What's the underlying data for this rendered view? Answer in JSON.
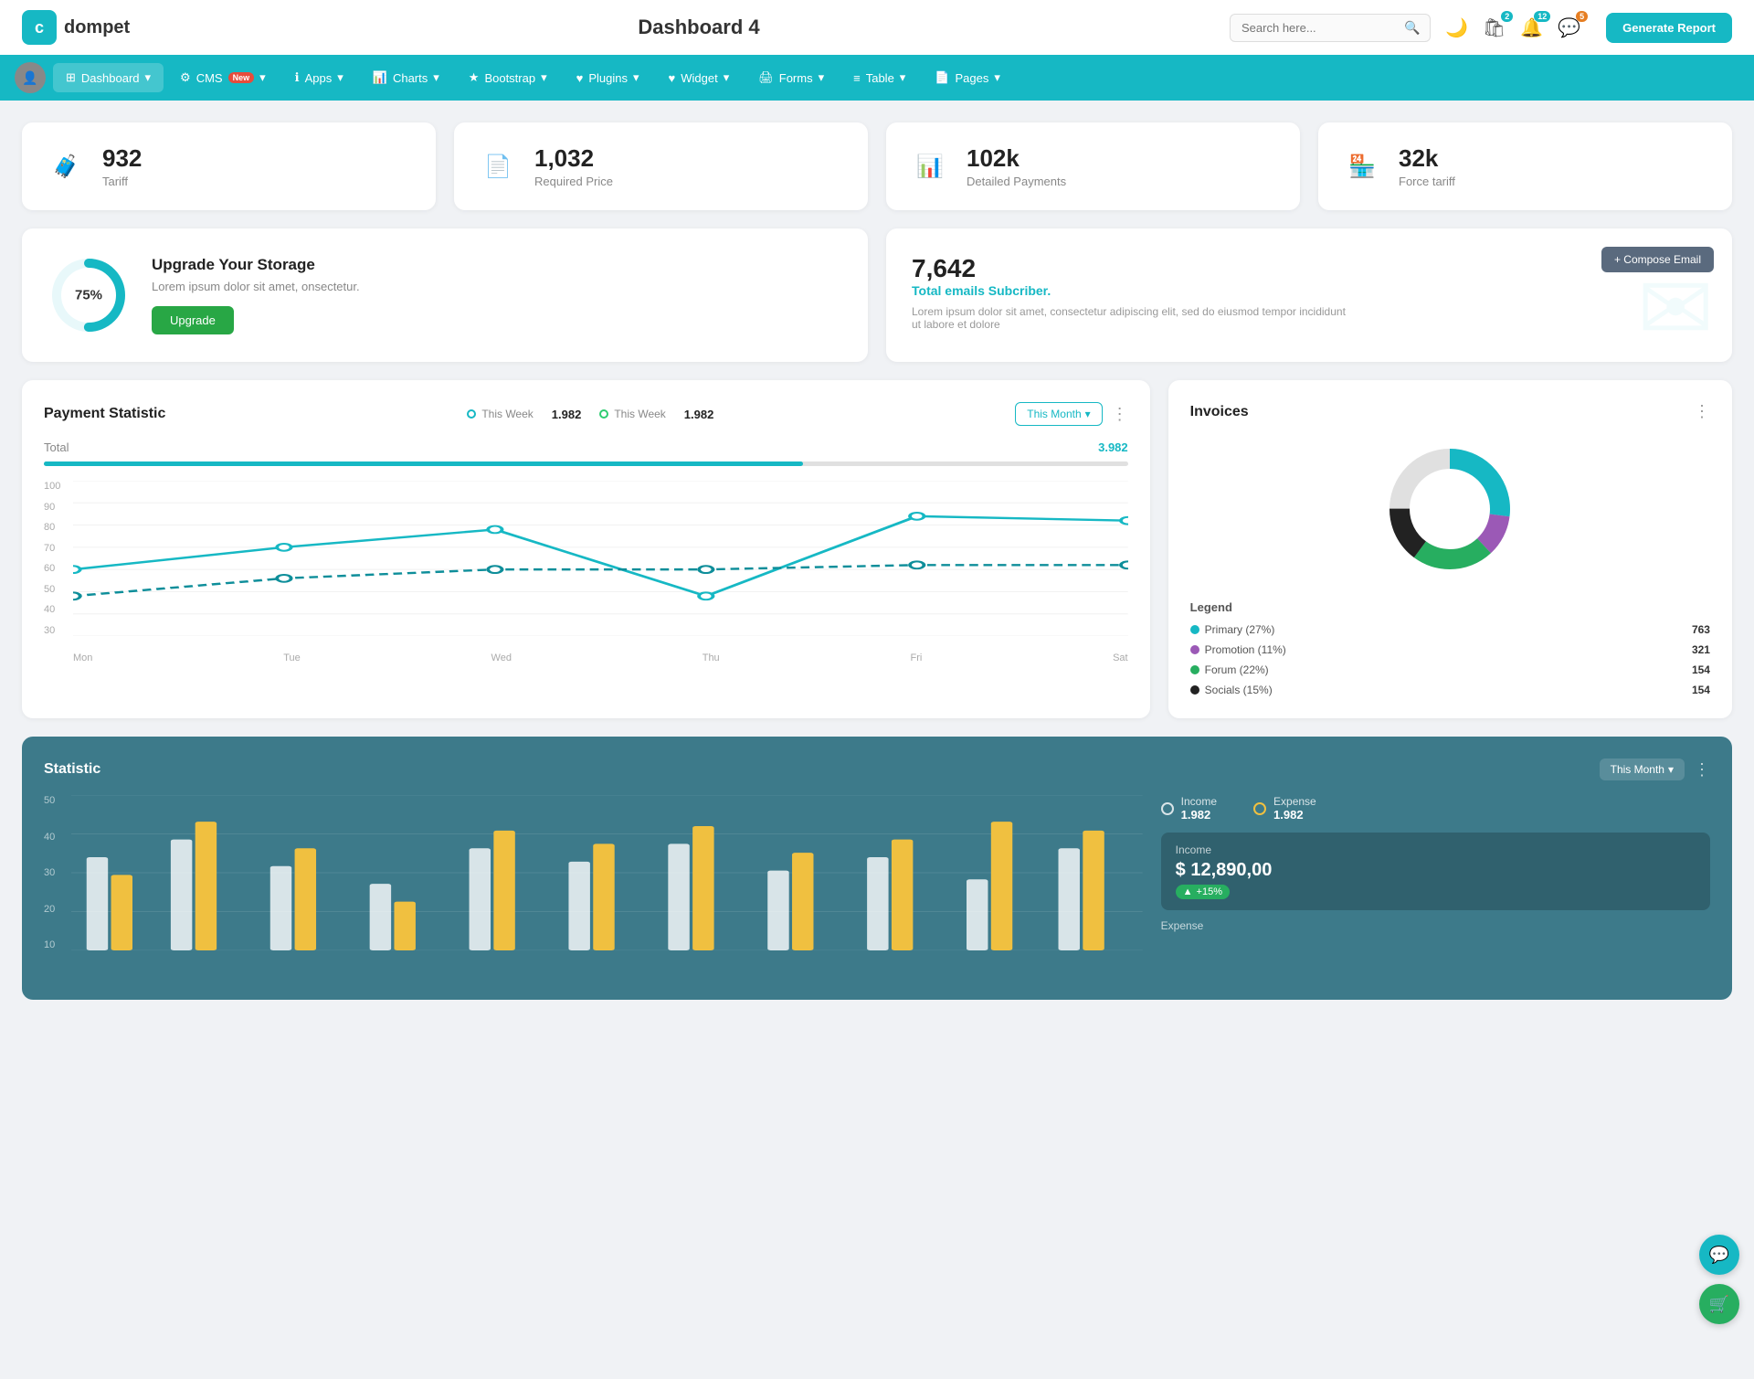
{
  "topbar": {
    "logo_text": "dompet",
    "page_title": "Dashboard 4",
    "search_placeholder": "Search here...",
    "icons": {
      "theme_toggle": "🌙",
      "shop_badge": "2",
      "bell_badge": "12",
      "chat_badge": "5"
    },
    "generate_report": "Generate Report"
  },
  "navbar": {
    "items": [
      {
        "id": "dashboard",
        "label": "Dashboard",
        "icon": "⊞",
        "active": true,
        "badge": null
      },
      {
        "id": "cms",
        "label": "CMS",
        "icon": "⚙",
        "active": false,
        "badge": "New"
      },
      {
        "id": "apps",
        "label": "Apps",
        "icon": "ℹ",
        "active": false,
        "badge": null
      },
      {
        "id": "charts",
        "label": "Charts",
        "icon": "📊",
        "active": false,
        "badge": null
      },
      {
        "id": "bootstrap",
        "label": "Bootstrap",
        "icon": "★",
        "active": false,
        "badge": null
      },
      {
        "id": "plugins",
        "label": "Plugins",
        "icon": "♥",
        "active": false,
        "badge": null
      },
      {
        "id": "widget",
        "label": "Widget",
        "icon": "♥",
        "active": false,
        "badge": null
      },
      {
        "id": "forms",
        "label": "Forms",
        "icon": "🖨",
        "active": false,
        "badge": null
      },
      {
        "id": "table",
        "label": "Table",
        "icon": "≡",
        "active": false,
        "badge": null
      },
      {
        "id": "pages",
        "label": "Pages",
        "icon": "📄",
        "active": false,
        "badge": null
      }
    ]
  },
  "stat_cards": [
    {
      "id": "tariff",
      "icon": "🧳",
      "icon_color": "#16b8c4",
      "value": "932",
      "label": "Tariff"
    },
    {
      "id": "required_price",
      "icon": "📄",
      "icon_color": "#e74c3c",
      "value": "1,032",
      "label": "Required Price"
    },
    {
      "id": "detailed_payments",
      "icon": "📊",
      "icon_color": "#9b59b6",
      "value": "102k",
      "label": "Detailed Payments"
    },
    {
      "id": "force_tariff",
      "icon": "🏪",
      "icon_color": "#e91e8c",
      "value": "32k",
      "label": "Force tariff"
    }
  ],
  "storage": {
    "percent": 75,
    "title": "Upgrade Your Storage",
    "description": "Lorem ipsum dolor sit amet, onsectetur.",
    "button_label": "Upgrade"
  },
  "email": {
    "count": "7,642",
    "subtitle": "Total emails Subcriber.",
    "description": "Lorem ipsum dolor sit amet, consectetur adipiscing elit, sed do eiusmod tempor incididunt ut labore et dolore",
    "compose_btn": "+ Compose Email"
  },
  "payment_statistic": {
    "title": "Payment Statistic",
    "legend": [
      {
        "label": "This Week",
        "value": "1.982",
        "color": "blue"
      },
      {
        "label": "This Week",
        "value": "1.982",
        "color": "teal"
      }
    ],
    "filter_label": "This Month",
    "total_label": "Total",
    "total_value": "3.982",
    "progress_percent": 70,
    "x_axis": [
      "Mon",
      "Tue",
      "Wed",
      "Thu",
      "Fri",
      "Sat"
    ],
    "y_axis": [
      "100",
      "90",
      "80",
      "70",
      "60",
      "50",
      "40",
      "30"
    ]
  },
  "invoices": {
    "title": "Invoices",
    "donut": {
      "segments": [
        {
          "label": "Primary (27%)",
          "color": "#16b8c4",
          "value": 763,
          "percent": 27
        },
        {
          "label": "Promotion (11%)",
          "color": "#9b59b6",
          "value": 321,
          "percent": 11
        },
        {
          "label": "Forum (22%)",
          "color": "#27ae60",
          "value": 154,
          "percent": 22
        },
        {
          "label": "Socials (15%)",
          "color": "#333",
          "value": 154,
          "percent": 15
        }
      ]
    }
  },
  "statistic": {
    "title": "Statistic",
    "filter_label": "This Month",
    "y_axis": [
      "50",
      "40",
      "30",
      "20",
      "10"
    ],
    "income_label": "Income",
    "income_value": "1.982",
    "expense_label": "Expense",
    "expense_value": "1.982",
    "income_box": {
      "label": "Income",
      "value": "$ 12,890,00",
      "badge": "+15%"
    }
  },
  "fabs": {
    "support": "💬",
    "cart": "🛒"
  }
}
